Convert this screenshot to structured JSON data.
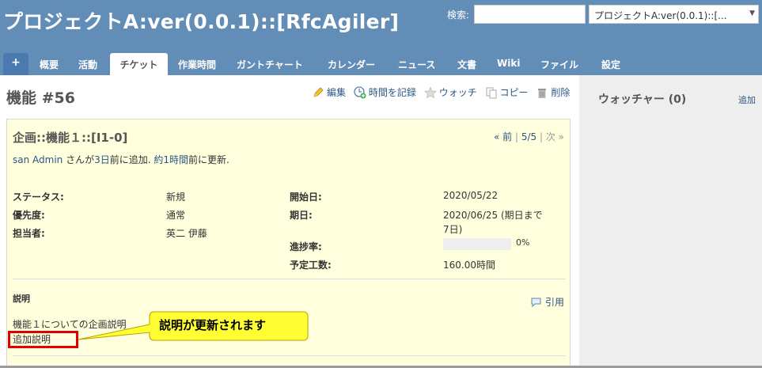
{
  "header": {
    "project_title": "プロジェクトA:ver(0.0.1)::[RfcAgiler]",
    "search_label": "検索:",
    "search_value": "",
    "jump_value": "プロジェクトA:ver(0.0.1)::[...",
    "background_color": "#628db6"
  },
  "menu": {
    "plus": "+",
    "tabs": [
      "概要",
      "活動",
      "チケット",
      "作業時間",
      "ガントチャート",
      "カレンダー",
      "ニュース",
      "文書",
      "Wiki",
      "ファイル",
      "設定"
    ],
    "selected": "チケット"
  },
  "issue": {
    "title": "機能 #56",
    "actions": {
      "edit": "編集",
      "log_time": "時間を記録",
      "watch": "ウォッチ",
      "copy": "コピー",
      "delete": "削除"
    },
    "subject": "企画::機能１::[I1-0]",
    "nav": {
      "prev": "« 前",
      "position": "5/5",
      "next": "次 »"
    },
    "author_line": {
      "author": "san Admin",
      "t1": " さんが",
      "added": "3日",
      "t2": "前に追加. ",
      "updated": "約1時間",
      "t3": "前に更新."
    },
    "attributes": {
      "status_label": "ステータス:",
      "status": "新規",
      "priority_label": "優先度:",
      "priority": "通常",
      "assignee_label": "担当者:",
      "assignee": "英二 伊藤",
      "start_label": "開始日:",
      "start": "2020/05/22",
      "due_label": "期日:",
      "due_line1": "2020/06/25 (期日まで",
      "due_line2": "7日)",
      "progress_label": "進捗率:",
      "progress_text": "0%",
      "progress": 0,
      "estimated_label": "予定工数:",
      "estimated": "160.00時間"
    },
    "description": {
      "label": "説明",
      "quote": "引用",
      "line1": "機能１についての企画説明",
      "line2": "追加説明"
    },
    "box_color": "#ffffdd"
  },
  "annotation": {
    "callout_text": "説明が更新されます",
    "callout_color": "#ffff33",
    "highlight_color": "#e00000"
  },
  "sidebar": {
    "watchers_title": "ウォッチャー (0)",
    "add": "追加"
  }
}
